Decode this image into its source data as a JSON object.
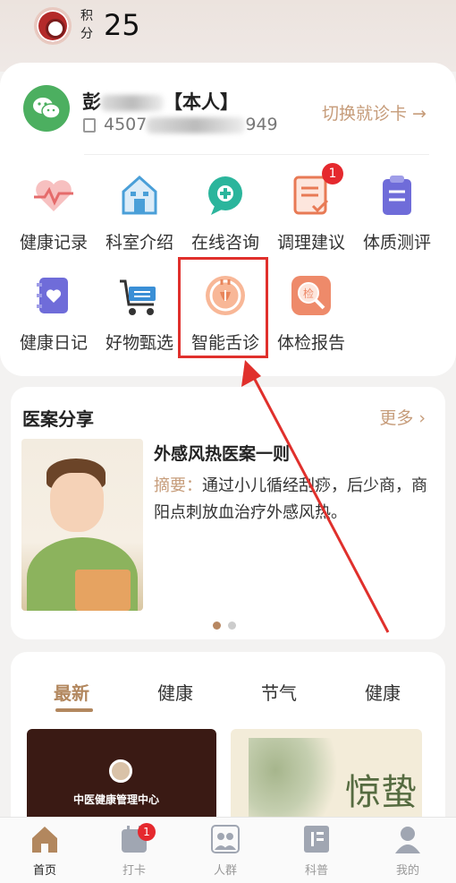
{
  "header": {
    "points_label": "积分",
    "points_value": "25"
  },
  "profile": {
    "name_prefix": "彭",
    "name_suffix": "【本人】",
    "card_prefix": "4507",
    "card_suffix": "949",
    "switch_label": "切换就诊卡 →"
  },
  "grid": [
    {
      "label": "健康记录",
      "icon": "heart-pulse-icon",
      "color": "#e56b6b"
    },
    {
      "label": "科室介绍",
      "icon": "building-icon",
      "color": "#4a9fd8"
    },
    {
      "label": "在线咨询",
      "icon": "chat-plus-icon",
      "color": "#2bb59c"
    },
    {
      "label": "调理建议",
      "icon": "checklist-icon",
      "color": "#e87a55",
      "badge": "1"
    },
    {
      "label": "体质测评",
      "icon": "clipboard-icon",
      "color": "#6f6cd9"
    },
    {
      "label": "健康日记",
      "icon": "heart-notebook-icon",
      "color": "#6f6cd9"
    },
    {
      "label": "好物甄选",
      "icon": "shopping-cart-icon",
      "color": "#3a8fd6"
    },
    {
      "label": "智能舌诊",
      "icon": "tongue-scan-icon",
      "color": "#e8855b"
    },
    {
      "label": "体检报告",
      "icon": "search-report-icon",
      "color": "#ee8a6a"
    }
  ],
  "case_share": {
    "title": "医案分享",
    "more": "更多 ›",
    "item_title": "外感风热医案一则",
    "summary_key": "摘要：",
    "summary_text": "通过小儿循经刮痧，后少商，商阳点刺放血治疗外感风热。"
  },
  "news": {
    "tabs": [
      "最新",
      "健康",
      "节气",
      "健康"
    ],
    "thumb1_text": "中医健康管理中心",
    "thumb2_char": "惊蛰"
  },
  "tabbar": [
    {
      "label": "首页",
      "icon": "home-icon",
      "active": true
    },
    {
      "label": "打卡",
      "icon": "calendar-icon",
      "badge": "1"
    },
    {
      "label": "人群",
      "icon": "people-icon"
    },
    {
      "label": "科普",
      "icon": "book-icon"
    },
    {
      "label": "我的",
      "icon": "user-icon"
    }
  ],
  "colors": {
    "accent": "#c69c7a",
    "highlight": "#e0302c",
    "badge": "#e5292e"
  }
}
